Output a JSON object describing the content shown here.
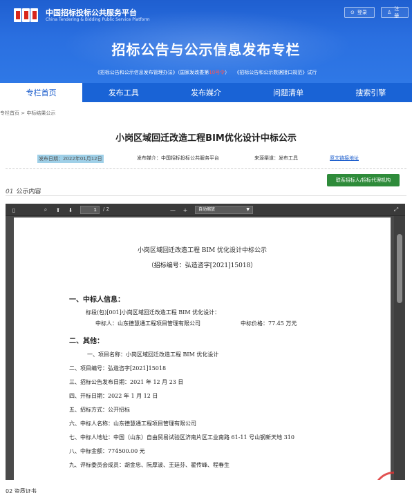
{
  "header": {
    "brand_cn": "中国招标投标公共服务平台",
    "brand_en": "China Tendering & Bidding Public Service Platform",
    "login": "登录",
    "register": "注册",
    "main_title": "招标公告与公示信息发布专栏",
    "law_a": "《招标公告和公示信息发布管理办法》（国家发改委第",
    "law_b": "10号令",
    "law_c": "）　　《招标公告和公示数据接口规范》试行"
  },
  "nav": {
    "items": [
      "专栏首页",
      "发布工具",
      "发布媒介",
      "问题清单",
      "搜索引擎"
    ]
  },
  "breadcrumb": "专栏首页 > 中标结果公示",
  "notice": {
    "title": "小岗区域回迁改造工程BIM优化设计中标公示",
    "date": "发布日期：2022年01月12日",
    "media": "发布媒介：中国招标投标公共服务平台",
    "source": "来源渠道：发布工具",
    "link": "原文链接地址",
    "contact_button": "联系招标人/招标代理机构",
    "section_num": "01",
    "section_label": "公示内容"
  },
  "viewer": {
    "page": "1",
    "total": "/ 2",
    "zoom": "自动缩放",
    "zoom_minus": "—",
    "zoom_plus": "+"
  },
  "pdf": {
    "title": "小岗区域回迁改造工程 BIM 优化设计中标公示",
    "code": "（招标编号：弘造咨字[2021]15018）",
    "h1": "一、中标人信息：",
    "lot": "标段(包)[001]小岗区域回迁改造工程 BIM 优化设计：",
    "winner": "中标人：山东德慧通工程项目管理有限公司",
    "price": "中标价格：77.45 万元",
    "h2": "二、其他：",
    "items": [
      "一、项目名称：小岗区域回迁改造工程 BIM 优化设计",
      "二、项目编号：弘造咨字[2021]15018",
      "三、招标公告发布日期：2021 年 12 月 23 日",
      "四、开标日期：2022 年 1 月 12 日",
      "五、招标方式：公开招标",
      "六、中标人名称：山东德慧通工程项目管理有限公司",
      "七、中标人地址：中国（山东）自由贸易试验区济南片区工业南路 61-11 号山钢新天地 310",
      "八、中标金额：774500.00 元",
      "九、评标委员会成员：胡金忠、阮厚波、王廷芬、翟传峰、程春生"
    ]
  },
  "bottom": "02 资质证书",
  "colors": {
    "nav_bg": "#1963d6",
    "accent": "#1a5ccc",
    "contact_green": "#2e8b3a",
    "law_red": "#ff5252"
  }
}
